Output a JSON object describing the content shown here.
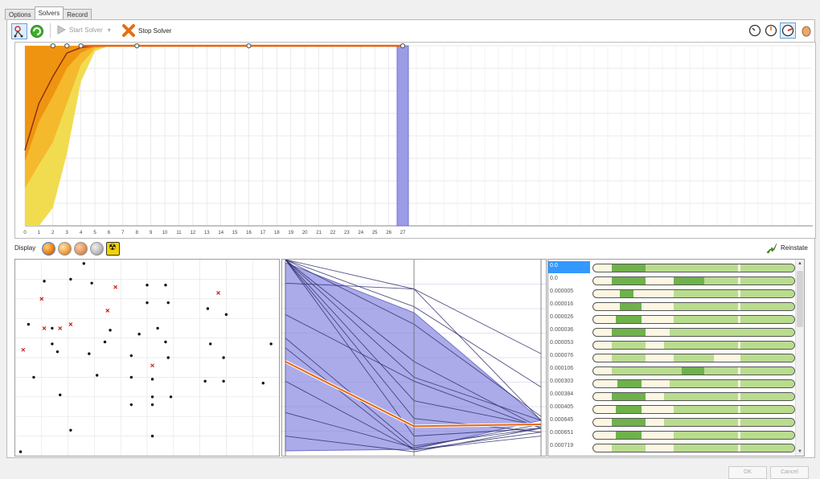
{
  "tabs": [
    {
      "label": "Options",
      "active": false
    },
    {
      "label": "Solvers",
      "active": true
    },
    {
      "label": "Record",
      "active": false
    }
  ],
  "toolbar": {
    "start_label": "Start Solver",
    "stop_label": "Stop Solver",
    "right_icons": [
      "clock-slow-icon",
      "clock-medium-icon",
      "clock-fast-icon",
      "egg-icon"
    ]
  },
  "display": {
    "label": "Display",
    "reinstate_label": "Reinstate",
    "buttons": [
      "orange-sphere-icon",
      "orange-half-sphere-icon",
      "orange-shaded-sphere-icon",
      "grey-sphere-icon",
      "radiation-icon"
    ]
  },
  "footer": {
    "ok_label": "OK",
    "cancel_label": "Cancel"
  },
  "colors": {
    "accent": "#e8650c",
    "band_outer": "#f1dc50",
    "band_mid": "#f5b92d",
    "band_inner": "#ef9410",
    "highlight": "#9c9ce6",
    "selected_row": "#3399ff",
    "slider_green": "#6fb14a",
    "slider_light": "#b9dc8e"
  },
  "chart_data": {
    "type": "line",
    "x": [
      0,
      1,
      2,
      3,
      4,
      5,
      6,
      7,
      8,
      9,
      10,
      11,
      12,
      13,
      14,
      15,
      16,
      17,
      18,
      19,
      20,
      21,
      22,
      23,
      24,
      25,
      26,
      27
    ],
    "series": [
      {
        "values": [
          42,
          68,
          83,
          96,
          99,
          100,
          100,
          100,
          100,
          100,
          100,
          100,
          100,
          100,
          100,
          100,
          100,
          100,
          100,
          100,
          100,
          100,
          100,
          100,
          100,
          100,
          100,
          100
        ]
      }
    ],
    "band_low": [
      0,
      0,
      10,
      40,
      80,
      97,
      100,
      100,
      100,
      100,
      100,
      100,
      100,
      100,
      100,
      100,
      100,
      100,
      100,
      100,
      100,
      100,
      100,
      100,
      100,
      100,
      100,
      100
    ],
    "band_high": [
      100,
      100,
      100,
      100,
      100,
      100,
      100,
      100,
      100,
      100,
      100,
      100,
      100,
      100,
      100,
      100,
      100,
      100,
      100,
      100,
      100,
      100,
      100,
      100,
      100,
      100,
      100,
      100
    ],
    "markers_x": [
      2,
      3,
      4,
      8,
      16,
      27
    ],
    "highlight_x": 27,
    "xlim": [
      0,
      27
    ],
    "grid": true
  },
  "scatter": {
    "black_points": [
      [
        0.11,
        0.11
      ],
      [
        0.21,
        0.1
      ],
      [
        0.29,
        0.12
      ],
      [
        0.5,
        0.13
      ],
      [
        0.57,
        0.13
      ],
      [
        0.5,
        0.22
      ],
      [
        0.58,
        0.22
      ],
      [
        0.73,
        0.25
      ],
      [
        0.8,
        0.28
      ],
      [
        0.14,
        0.35
      ],
      [
        0.05,
        0.33
      ],
      [
        0.14,
        0.43
      ],
      [
        0.16,
        0.47
      ],
      [
        0.28,
        0.48
      ],
      [
        0.34,
        0.42
      ],
      [
        0.36,
        0.36
      ],
      [
        0.47,
        0.38
      ],
      [
        0.54,
        0.35
      ],
      [
        0.57,
        0.42
      ],
      [
        0.74,
        0.43
      ],
      [
        0.79,
        0.5
      ],
      [
        0.44,
        0.49
      ],
      [
        0.58,
        0.5
      ],
      [
        0.31,
        0.59
      ],
      [
        0.07,
        0.6
      ],
      [
        0.44,
        0.6
      ],
      [
        0.52,
        0.61
      ],
      [
        0.72,
        0.62
      ],
      [
        0.79,
        0.62
      ],
      [
        0.97,
        0.43
      ],
      [
        0.17,
        0.69
      ],
      [
        0.44,
        0.74
      ],
      [
        0.52,
        0.7
      ],
      [
        0.52,
        0.74
      ],
      [
        0.59,
        0.7
      ],
      [
        0.52,
        0.9
      ],
      [
        0.21,
        0.87
      ],
      [
        0.02,
        0.98
      ],
      [
        0.94,
        0.63
      ],
      [
        0.26,
        0.02
      ]
    ],
    "red_points": [
      [
        0.1,
        0.2
      ],
      [
        0.38,
        0.14
      ],
      [
        0.77,
        0.17
      ],
      [
        0.35,
        0.26
      ],
      [
        0.11,
        0.35
      ],
      [
        0.17,
        0.35
      ],
      [
        0.21,
        0.33
      ],
      [
        0.03,
        0.46
      ],
      [
        0.52,
        0.54
      ]
    ]
  },
  "parallel": {
    "lines": [
      [
        0.0,
        0.15,
        0.48
      ],
      [
        0.0,
        0.24,
        0.65
      ],
      [
        0.0,
        0.33,
        0.8
      ],
      [
        0.0,
        0.52,
        0.86
      ],
      [
        0.0,
        0.6,
        0.82
      ],
      [
        0.0,
        0.72,
        0.85
      ],
      [
        0.0,
        0.81,
        0.88
      ],
      [
        0.0,
        0.9,
        0.86
      ],
      [
        0.12,
        0.15,
        0.82
      ],
      [
        0.28,
        0.62,
        0.86
      ],
      [
        0.4,
        0.95,
        0.86
      ],
      [
        0.45,
        0.97,
        0.9
      ],
      [
        0.62,
        0.97,
        0.88
      ],
      [
        0.78,
        0.96,
        0.84
      ],
      [
        0.9,
        0.98,
        0.86
      ]
    ],
    "highlight_line": [
      0.52,
      0.85,
      0.84
    ]
  },
  "slider_rows": [
    {
      "label": "0.0",
      "selected": true,
      "dark": [
        [
          0.09,
          0.26
        ]
      ],
      "light": [
        [
          0.26,
          0.4
        ],
        [
          0.4,
          0.72
        ],
        [
          0.73,
          1.0
        ]
      ]
    },
    {
      "label": "0.0",
      "selected": false,
      "dark": [
        [
          0.09,
          0.26
        ],
        [
          0.4,
          0.55
        ]
      ],
      "light": [
        [
          0.55,
          0.72
        ],
        [
          0.73,
          1.0
        ]
      ]
    },
    {
      "label": "0.000005",
      "selected": false,
      "dark": [
        [
          0.13,
          0.2
        ]
      ],
      "light": [
        [
          0.4,
          0.72
        ],
        [
          0.73,
          1.0
        ]
      ]
    },
    {
      "label": "0.000016",
      "selected": false,
      "dark": [
        [
          0.13,
          0.24
        ]
      ],
      "light": [
        [
          0.4,
          0.72
        ],
        [
          0.73,
          1.0
        ]
      ]
    },
    {
      "label": "0.000026",
      "selected": false,
      "dark": [
        [
          0.11,
          0.24
        ]
      ],
      "light": [
        [
          0.4,
          0.72
        ],
        [
          0.73,
          1.0
        ]
      ]
    },
    {
      "label": "0.000036",
      "selected": false,
      "dark": [
        [
          0.09,
          0.26
        ]
      ],
      "light": [
        [
          0.38,
          0.73
        ],
        [
          0.73,
          1.0
        ]
      ]
    },
    {
      "label": "0.000053",
      "selected": false,
      "dark": [],
      "light": [
        [
          0.09,
          0.26
        ],
        [
          0.35,
          0.72
        ],
        [
          0.73,
          1.0
        ]
      ]
    },
    {
      "label": "0.000076",
      "selected": false,
      "dark": [],
      "light": [
        [
          0.09,
          0.26
        ],
        [
          0.4,
          0.6
        ],
        [
          0.73,
          1.0
        ]
      ]
    },
    {
      "label": "0.000106",
      "selected": false,
      "dark": [
        [
          0.44,
          0.55
        ]
      ],
      "light": [
        [
          0.09,
          0.26
        ],
        [
          0.26,
          0.72
        ],
        [
          0.73,
          1.0
        ]
      ]
    },
    {
      "label": "0.000303",
      "selected": false,
      "dark": [
        [
          0.12,
          0.24
        ]
      ],
      "light": [
        [
          0.38,
          0.72
        ],
        [
          0.73,
          1.0
        ]
      ]
    },
    {
      "label": "0.000384",
      "selected": false,
      "dark": [
        [
          0.09,
          0.26
        ]
      ],
      "light": [
        [
          0.35,
          0.72
        ],
        [
          0.73,
          1.0
        ]
      ]
    },
    {
      "label": "0.000405",
      "selected": false,
      "dark": [
        [
          0.11,
          0.24
        ]
      ],
      "light": [
        [
          0.4,
          0.72
        ],
        [
          0.73,
          1.0
        ]
      ]
    },
    {
      "label": "0.000645",
      "selected": false,
      "dark": [
        [
          0.09,
          0.26
        ]
      ],
      "light": [
        [
          0.35,
          0.72
        ],
        [
          0.73,
          1.0
        ]
      ]
    },
    {
      "label": "0.000651",
      "selected": false,
      "dark": [
        [
          0.11,
          0.24
        ]
      ],
      "light": [
        [
          0.4,
          0.72
        ],
        [
          0.73,
          1.0
        ]
      ]
    },
    {
      "label": "0.000719",
      "selected": false,
      "dark": [],
      "light": [
        [
          0.09,
          0.26
        ],
        [
          0.4,
          0.72
        ],
        [
          0.73,
          1.0
        ]
      ]
    }
  ]
}
